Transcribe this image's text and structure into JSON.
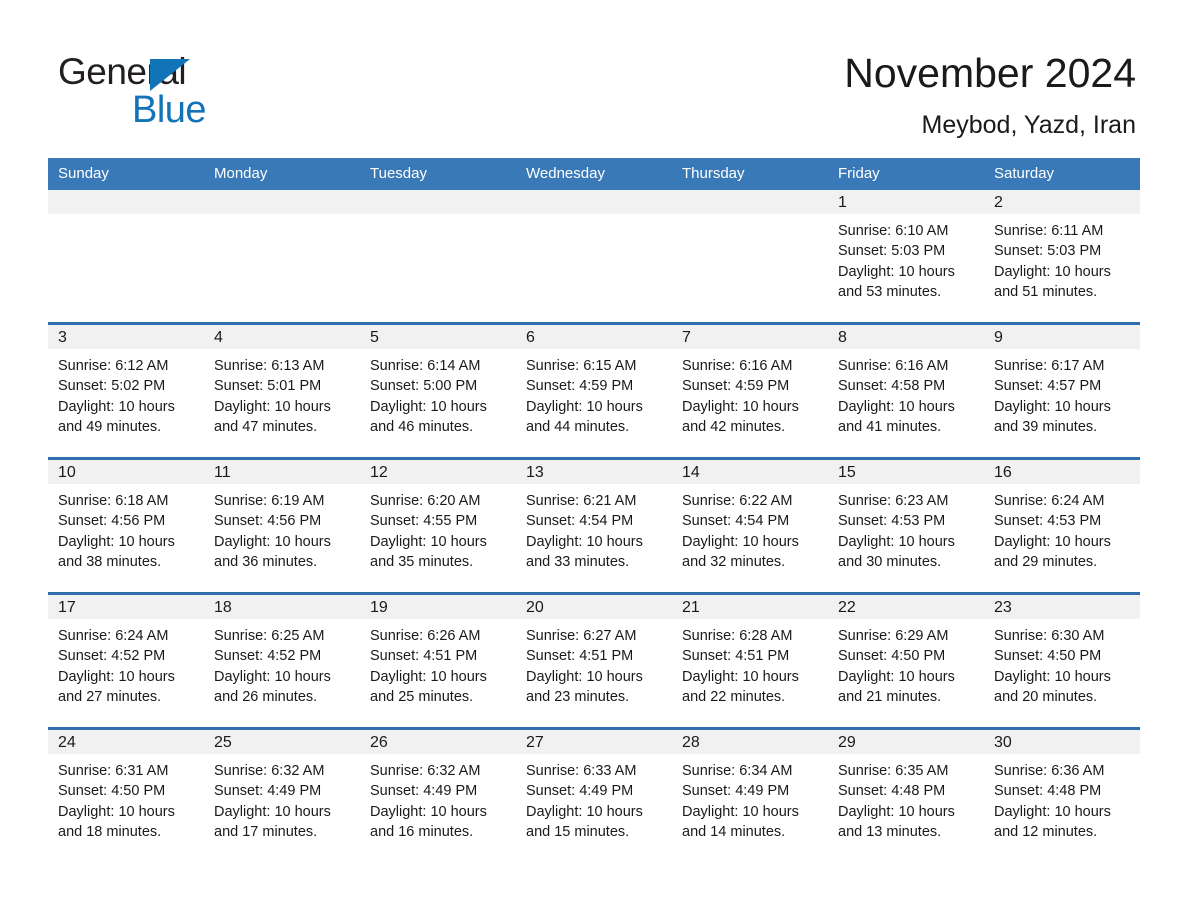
{
  "brand": {
    "name_part1": "General",
    "name_part2": "Blue",
    "triangle_icon": "brand-triangle-icon",
    "accent_color": "#1274b8"
  },
  "header": {
    "title": "November 2024",
    "subtitle": "Meybod, Yazd, Iran"
  },
  "theme": {
    "header_band": "#3a79b8",
    "row_rule": "#2f6fae",
    "daynum_band": "#f1f1f1",
    "page_background": "#ffffff",
    "text": "#1a1a1a"
  },
  "weekday_headers": [
    "Sunday",
    "Monday",
    "Tuesday",
    "Wednesday",
    "Thursday",
    "Friday",
    "Saturday"
  ],
  "weeks": [
    [
      {
        "day": "",
        "lines": []
      },
      {
        "day": "",
        "lines": []
      },
      {
        "day": "",
        "lines": []
      },
      {
        "day": "",
        "lines": []
      },
      {
        "day": "",
        "lines": []
      },
      {
        "day": "1",
        "lines": [
          "Sunrise: 6:10 AM",
          "Sunset: 5:03 PM",
          "Daylight: 10 hours",
          "and 53 minutes."
        ]
      },
      {
        "day": "2",
        "lines": [
          "Sunrise: 6:11 AM",
          "Sunset: 5:03 PM",
          "Daylight: 10 hours",
          "and 51 minutes."
        ]
      }
    ],
    [
      {
        "day": "3",
        "lines": [
          "Sunrise: 6:12 AM",
          "Sunset: 5:02 PM",
          "Daylight: 10 hours",
          "and 49 minutes."
        ]
      },
      {
        "day": "4",
        "lines": [
          "Sunrise: 6:13 AM",
          "Sunset: 5:01 PM",
          "Daylight: 10 hours",
          "and 47 minutes."
        ]
      },
      {
        "day": "5",
        "lines": [
          "Sunrise: 6:14 AM",
          "Sunset: 5:00 PM",
          "Daylight: 10 hours",
          "and 46 minutes."
        ]
      },
      {
        "day": "6",
        "lines": [
          "Sunrise: 6:15 AM",
          "Sunset: 4:59 PM",
          "Daylight: 10 hours",
          "and 44 minutes."
        ]
      },
      {
        "day": "7",
        "lines": [
          "Sunrise: 6:16 AM",
          "Sunset: 4:59 PM",
          "Daylight: 10 hours",
          "and 42 minutes."
        ]
      },
      {
        "day": "8",
        "lines": [
          "Sunrise: 6:16 AM",
          "Sunset: 4:58 PM",
          "Daylight: 10 hours",
          "and 41 minutes."
        ]
      },
      {
        "day": "9",
        "lines": [
          "Sunrise: 6:17 AM",
          "Sunset: 4:57 PM",
          "Daylight: 10 hours",
          "and 39 minutes."
        ]
      }
    ],
    [
      {
        "day": "10",
        "lines": [
          "Sunrise: 6:18 AM",
          "Sunset: 4:56 PM",
          "Daylight: 10 hours",
          "and 38 minutes."
        ]
      },
      {
        "day": "11",
        "lines": [
          "Sunrise: 6:19 AM",
          "Sunset: 4:56 PM",
          "Daylight: 10 hours",
          "and 36 minutes."
        ]
      },
      {
        "day": "12",
        "lines": [
          "Sunrise: 6:20 AM",
          "Sunset: 4:55 PM",
          "Daylight: 10 hours",
          "and 35 minutes."
        ]
      },
      {
        "day": "13",
        "lines": [
          "Sunrise: 6:21 AM",
          "Sunset: 4:54 PM",
          "Daylight: 10 hours",
          "and 33 minutes."
        ]
      },
      {
        "day": "14",
        "lines": [
          "Sunrise: 6:22 AM",
          "Sunset: 4:54 PM",
          "Daylight: 10 hours",
          "and 32 minutes."
        ]
      },
      {
        "day": "15",
        "lines": [
          "Sunrise: 6:23 AM",
          "Sunset: 4:53 PM",
          "Daylight: 10 hours",
          "and 30 minutes."
        ]
      },
      {
        "day": "16",
        "lines": [
          "Sunrise: 6:24 AM",
          "Sunset: 4:53 PM",
          "Daylight: 10 hours",
          "and 29 minutes."
        ]
      }
    ],
    [
      {
        "day": "17",
        "lines": [
          "Sunrise: 6:24 AM",
          "Sunset: 4:52 PM",
          "Daylight: 10 hours",
          "and 27 minutes."
        ]
      },
      {
        "day": "18",
        "lines": [
          "Sunrise: 6:25 AM",
          "Sunset: 4:52 PM",
          "Daylight: 10 hours",
          "and 26 minutes."
        ]
      },
      {
        "day": "19",
        "lines": [
          "Sunrise: 6:26 AM",
          "Sunset: 4:51 PM",
          "Daylight: 10 hours",
          "and 25 minutes."
        ]
      },
      {
        "day": "20",
        "lines": [
          "Sunrise: 6:27 AM",
          "Sunset: 4:51 PM",
          "Daylight: 10 hours",
          "and 23 minutes."
        ]
      },
      {
        "day": "21",
        "lines": [
          "Sunrise: 6:28 AM",
          "Sunset: 4:51 PM",
          "Daylight: 10 hours",
          "and 22 minutes."
        ]
      },
      {
        "day": "22",
        "lines": [
          "Sunrise: 6:29 AM",
          "Sunset: 4:50 PM",
          "Daylight: 10 hours",
          "and 21 minutes."
        ]
      },
      {
        "day": "23",
        "lines": [
          "Sunrise: 6:30 AM",
          "Sunset: 4:50 PM",
          "Daylight: 10 hours",
          "and 20 minutes."
        ]
      }
    ],
    [
      {
        "day": "24",
        "lines": [
          "Sunrise: 6:31 AM",
          "Sunset: 4:50 PM",
          "Daylight: 10 hours",
          "and 18 minutes."
        ]
      },
      {
        "day": "25",
        "lines": [
          "Sunrise: 6:32 AM",
          "Sunset: 4:49 PM",
          "Daylight: 10 hours",
          "and 17 minutes."
        ]
      },
      {
        "day": "26",
        "lines": [
          "Sunrise: 6:32 AM",
          "Sunset: 4:49 PM",
          "Daylight: 10 hours",
          "and 16 minutes."
        ]
      },
      {
        "day": "27",
        "lines": [
          "Sunrise: 6:33 AM",
          "Sunset: 4:49 PM",
          "Daylight: 10 hours",
          "and 15 minutes."
        ]
      },
      {
        "day": "28",
        "lines": [
          "Sunrise: 6:34 AM",
          "Sunset: 4:49 PM",
          "Daylight: 10 hours",
          "and 14 minutes."
        ]
      },
      {
        "day": "29",
        "lines": [
          "Sunrise: 6:35 AM",
          "Sunset: 4:48 PM",
          "Daylight: 10 hours",
          "and 13 minutes."
        ]
      },
      {
        "day": "30",
        "lines": [
          "Sunrise: 6:36 AM",
          "Sunset: 4:48 PM",
          "Daylight: 10 hours",
          "and 12 minutes."
        ]
      }
    ]
  ]
}
